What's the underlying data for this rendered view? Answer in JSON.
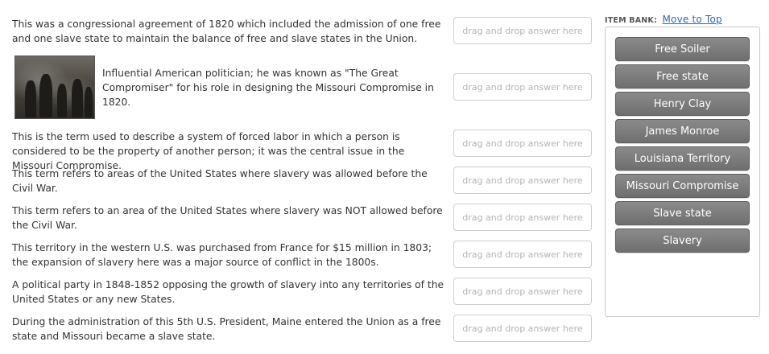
{
  "questions": [
    {
      "text": "This was a congressional agreement of 1820 which included the admission of one free and one slave state to maintain the balance of free and slave states in the Union."
    },
    {
      "text": "Influential American politician; he was known as \"The Great Compromiser\" for his role in designing the Missouri Compromise in 1820.",
      "has_image": true
    },
    {
      "text": "This is the term used to describe a system of forced labor in which a person is considered to be the property of another person; it was the central issue in the Missouri Compromise."
    },
    {
      "text": "This term refers to areas of the United States where slavery was allowed before the Civil War."
    },
    {
      "text": "This term refers to an area of the United States where slavery was NOT allowed before the Civil War."
    },
    {
      "text": "This territory in the western U.S. was purchased from France for $15 million in 1803; the expansion of slavery here was a major source of conflict in the 1800s."
    },
    {
      "text": "A political party in 1848-1852 opposing the growth of slavery into any territories of the United States or any new States."
    },
    {
      "text": "During the administration of this 5th U.S. President, Maine entered the Union as a free state and Missouri became a slave state."
    }
  ],
  "drop_placeholder": "drag and drop answer here",
  "item_bank": {
    "label": "ITEM BANK:",
    "move_link": "Move to Top",
    "items": [
      "Free Soiler",
      "Free state",
      "Henry Clay",
      "James Monroe",
      "Louisiana Territory",
      "Missouri Compromise",
      "Slave state",
      "Slavery"
    ]
  },
  "colors": {
    "chip_background": "#7d7d7d",
    "link": "#3366aa",
    "placeholder_text": "#b5b5b5"
  },
  "icons": {
    "question_image": "historical-painting-image"
  }
}
